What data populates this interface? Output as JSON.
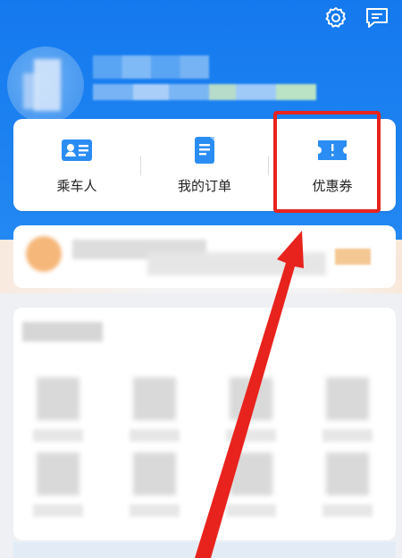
{
  "quick_actions": [
    {
      "label": "乘车人",
      "icon": "passenger-card-icon"
    },
    {
      "label": "我的订单",
      "icon": "orders-icon"
    },
    {
      "label": "优惠券",
      "icon": "coupon-icon"
    }
  ],
  "header": {
    "icons": [
      "gear-icon",
      "message-icon"
    ]
  },
  "colors": {
    "header_blue": "#1479ee",
    "icon_blue": "#2b8df3",
    "highlight_red": "#e8231d"
  }
}
